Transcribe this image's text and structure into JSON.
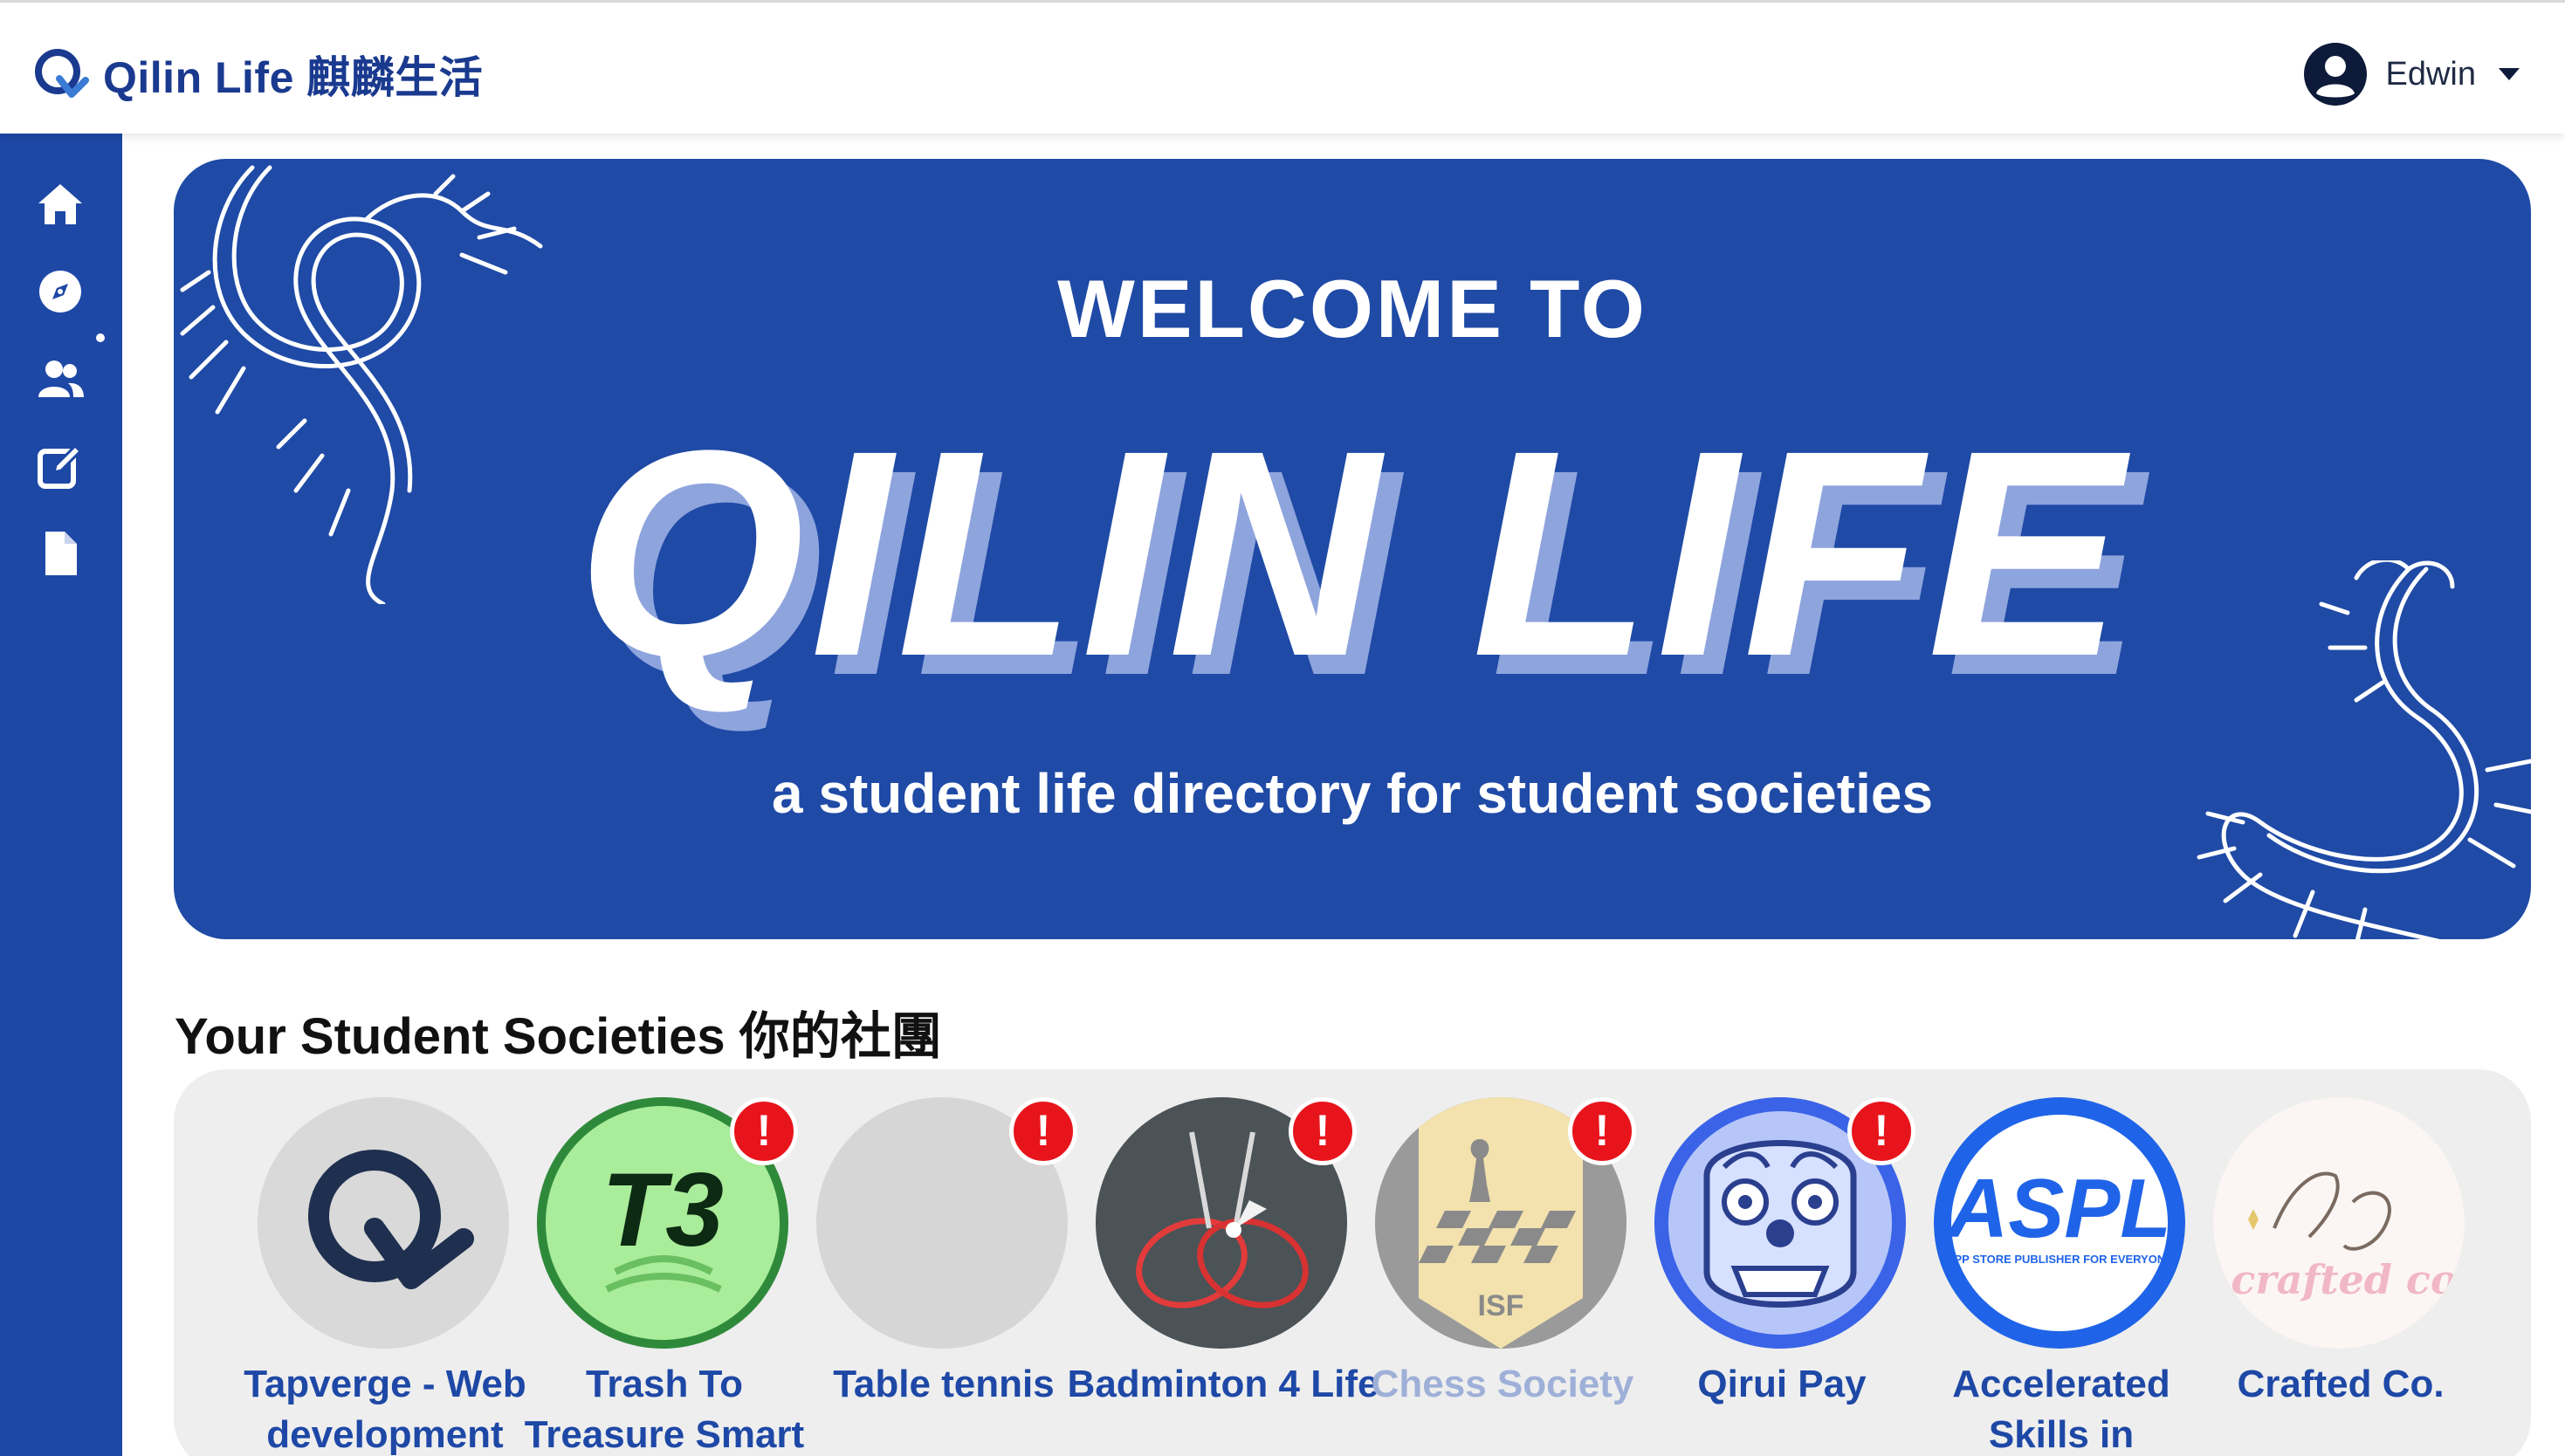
{
  "app": {
    "brand_name": "Qilin Life 麒麟生活",
    "brand_color": "#1a3a8f",
    "accent_color": "#1e48a6"
  },
  "user": {
    "name": "Edwin",
    "avatar_icon": "user-circle-icon"
  },
  "sidebar": {
    "items": [
      {
        "name": "home",
        "icon": "home-icon",
        "active": true
      },
      {
        "name": "explore",
        "icon": "compass-icon",
        "active": false
      },
      {
        "name": "societies",
        "icon": "users-icon",
        "active": false
      },
      {
        "name": "edit",
        "icon": "edit-icon",
        "active": false
      },
      {
        "name": "documents",
        "icon": "file-icon",
        "active": false
      }
    ]
  },
  "hero": {
    "welcome": "WELCOME TO",
    "title": "QILIN LIFE",
    "subtitle": "a student life directory for student societies"
  },
  "societies_section": {
    "title": "Your Student Societies 你的社團",
    "items": [
      {
        "name": "Tapverge - Web development",
        "has_alert": false,
        "dimmed": false
      },
      {
        "name": "Trash To Treasure Smart",
        "has_alert": true,
        "dimmed": false
      },
      {
        "name": "Table tennis",
        "has_alert": true,
        "dimmed": false
      },
      {
        "name": "Badminton 4 Life",
        "has_alert": true,
        "dimmed": false
      },
      {
        "name": "Chess Society",
        "has_alert": true,
        "dimmed": true
      },
      {
        "name": "Qirui Pay",
        "has_alert": true,
        "dimmed": false
      },
      {
        "name": "Accelerated Skills in",
        "has_alert": false,
        "dimmed": false
      },
      {
        "name": "Crafted Co.",
        "has_alert": false,
        "dimmed": false
      }
    ],
    "alert_symbol": "!",
    "logo_texts": {
      "t3": "T3",
      "isf": "ISF",
      "aspl": "ASPL",
      "aspl_tagline": "APP STORE PUBLISHER FOR EVERYONE",
      "crafted": "crafted co"
    }
  }
}
